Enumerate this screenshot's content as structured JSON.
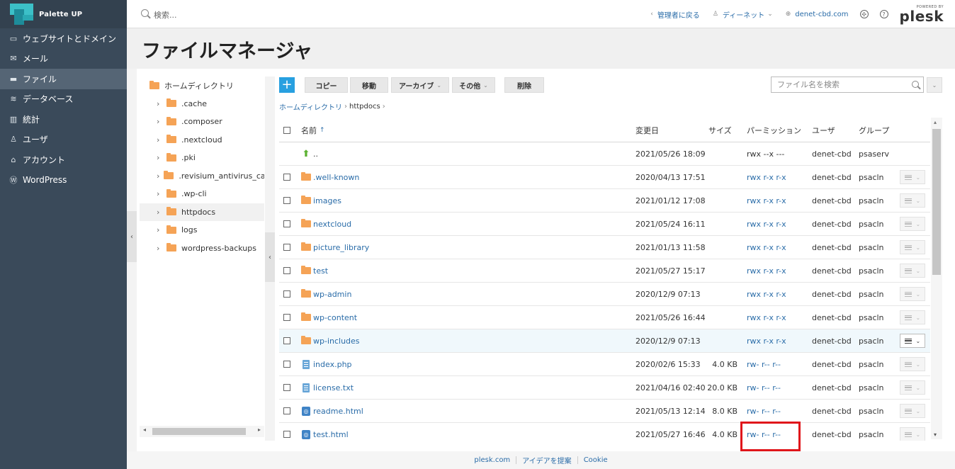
{
  "brand": {
    "name": "Palette UP"
  },
  "sidebar": {
    "items": [
      {
        "label": "ウェブサイトとドメイン",
        "icon": "monitor-icon",
        "active": false
      },
      {
        "label": "メール",
        "icon": "mail-icon",
        "active": false
      },
      {
        "label": "ファイル",
        "icon": "folder-icon",
        "active": true
      },
      {
        "label": "データベース",
        "icon": "database-icon",
        "active": false
      },
      {
        "label": "統計",
        "icon": "chart-icon",
        "active": false
      },
      {
        "label": "ユーザ",
        "icon": "user-icon",
        "active": false
      },
      {
        "label": "アカウント",
        "icon": "account-icon",
        "active": false
      },
      {
        "label": "WordPress",
        "icon": "wordpress-icon",
        "active": false
      }
    ]
  },
  "topbar": {
    "search_placeholder": "検索...",
    "back_to_admin": "管理者に戻る",
    "user": "ディーネット",
    "domain": "denet-cbd.com",
    "powered_by": "POWERED BY",
    "plesk": "plesk"
  },
  "header": {
    "title": "ファイルマネージャ"
  },
  "tree": {
    "root": "ホームディレクトリ",
    "items": [
      {
        "label": ".cache",
        "selected": false
      },
      {
        "label": ".composer",
        "selected": false
      },
      {
        "label": ".nextcloud",
        "selected": false
      },
      {
        "label": ".pki",
        "selected": false
      },
      {
        "label": ".revisium_antivirus_cache",
        "selected": false
      },
      {
        "label": ".wp-cli",
        "selected": false
      },
      {
        "label": "httpdocs",
        "selected": true
      },
      {
        "label": "logs",
        "selected": false
      },
      {
        "label": "wordpress-backups",
        "selected": false
      }
    ]
  },
  "toolbar": {
    "add_label": "+",
    "copy": "コピー",
    "move": "移動",
    "archive": "アーカイブ",
    "other": "その他",
    "delete": "削除",
    "file_search_placeholder": "ファイル名を検索"
  },
  "breadcrumb": {
    "home": "ホームディレクトリ",
    "current": "httpdocs"
  },
  "table": {
    "headers": {
      "name": "名前",
      "modified": "変更日",
      "size": "サイズ",
      "permission": "パーミッション",
      "user": "ユーザ",
      "group": "グループ"
    },
    "rows": [
      {
        "type": "up",
        "name": "..",
        "modified": "2021/05/26 18:09",
        "size": "",
        "permission": "rwx --x ---",
        "user": "denet-cbd",
        "group": "psaserv"
      },
      {
        "type": "folder",
        "name": ".well-known",
        "modified": "2020/04/13 17:51",
        "size": "",
        "permission": "rwx r-x r-x",
        "user": "denet-cbd",
        "group": "psacln"
      },
      {
        "type": "folder",
        "name": "images",
        "modified": "2021/01/12 17:08",
        "size": "",
        "permission": "rwx r-x r-x",
        "user": "denet-cbd",
        "group": "psacln"
      },
      {
        "type": "folder",
        "name": "nextcloud",
        "modified": "2021/05/24 16:11",
        "size": "",
        "permission": "rwx r-x r-x",
        "user": "denet-cbd",
        "group": "psacln"
      },
      {
        "type": "folder",
        "name": "picture_library",
        "modified": "2021/01/13 11:58",
        "size": "",
        "permission": "rwx r-x r-x",
        "user": "denet-cbd",
        "group": "psacln"
      },
      {
        "type": "folder",
        "name": "test",
        "modified": "2021/05/27 15:17",
        "size": "",
        "permission": "rwx r-x r-x",
        "user": "denet-cbd",
        "group": "psacln"
      },
      {
        "type": "folder",
        "name": "wp-admin",
        "modified": "2020/12/9 07:13",
        "size": "",
        "permission": "rwx r-x r-x",
        "user": "denet-cbd",
        "group": "psacln"
      },
      {
        "type": "folder",
        "name": "wp-content",
        "modified": "2021/05/26 16:44",
        "size": "",
        "permission": "rwx r-x r-x",
        "user": "denet-cbd",
        "group": "psacln"
      },
      {
        "type": "folder",
        "name": "wp-includes",
        "modified": "2020/12/9 07:13",
        "size": "",
        "permission": "rwx r-x r-x",
        "user": "denet-cbd",
        "group": "psacln"
      },
      {
        "type": "php",
        "name": "index.php",
        "modified": "2020/02/6 15:33",
        "size": "4.0 KB",
        "permission": "rw- r-- r--",
        "user": "denet-cbd",
        "group": "psacln"
      },
      {
        "type": "text",
        "name": "license.txt",
        "modified": "2021/04/16 02:40",
        "size": "20.0 KB",
        "permission": "rw- r-- r--",
        "user": "denet-cbd",
        "group": "psacln"
      },
      {
        "type": "html",
        "name": "readme.html",
        "modified": "2021/05/13 12:14",
        "size": "8.0 KB",
        "permission": "rw- r-- r--",
        "user": "denet-cbd",
        "group": "psacln"
      },
      {
        "type": "html",
        "name": "test.html",
        "modified": "2021/05/27 16:46",
        "size": "4.0 KB",
        "permission": "rw- r-- r--",
        "user": "denet-cbd",
        "group": "psacln"
      }
    ]
  },
  "footer": {
    "links": [
      "plesk.com",
      "アイデアを提案",
      "Cookie"
    ]
  },
  "colors": {
    "sidebar": "#3a4a5a",
    "accent": "#28a0e0",
    "link": "#2a6ca8",
    "folder": "#f5a356",
    "highlight": "#e0151b"
  }
}
